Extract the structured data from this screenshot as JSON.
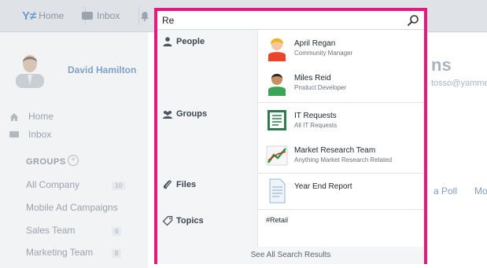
{
  "topbar": {
    "logo": "Y≠",
    "home_label": "Home",
    "inbox_label": "Inbox"
  },
  "profile": {
    "name": "David Hamilton"
  },
  "nav": {
    "home": "Home",
    "inbox": "Inbox"
  },
  "groups": {
    "heading": "GROUPS",
    "plus": "+",
    "items": [
      {
        "name": "All Company",
        "count": "10"
      },
      {
        "name": "Mobile Ad Campaigns",
        "count": ""
      },
      {
        "name": "Sales Team",
        "count": "6"
      },
      {
        "name": "Marketing Team",
        "count": "8"
      }
    ]
  },
  "background": {
    "title_fragment": "ns",
    "email_fragment": "tosso@yamme",
    "poll": "a Poll",
    "more": "Mo"
  },
  "search": {
    "value": "Re",
    "placeholder": ""
  },
  "categories": {
    "people": {
      "label": "People",
      "results": [
        {
          "title": "April Regan",
          "subtitle": "Community Manager"
        },
        {
          "title": "Miles Reid",
          "subtitle": "Product Developer"
        }
      ]
    },
    "groups": {
      "label": "Groups",
      "results": [
        {
          "title": "IT Requests",
          "subtitle": "All IT Requests"
        },
        {
          "title": "Market Research Team",
          "subtitle": "Anything Market Research Related"
        }
      ]
    },
    "files": {
      "label": "Files",
      "results": [
        {
          "title": "Year End Report"
        }
      ]
    },
    "topics": {
      "label": "Topics",
      "results": [
        {
          "title": "#Retail"
        }
      ]
    }
  },
  "see_all": "See All Search Results",
  "colors": {
    "highlight_border": "#e6197f",
    "link_blue": "#7e9fc4"
  }
}
